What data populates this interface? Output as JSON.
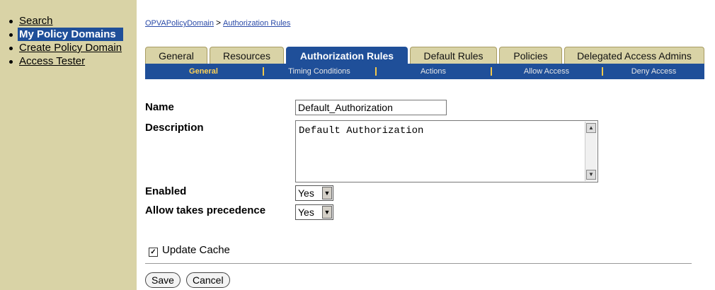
{
  "sidebar": {
    "items": [
      {
        "label": "Search"
      },
      {
        "label": "My Policy Domains"
      },
      {
        "label": "Create Policy Domain"
      },
      {
        "label": "Access Tester"
      }
    ]
  },
  "breadcrumb": {
    "domain": "OPVAPolicyDomain",
    "separator": ">",
    "current": "Authorization Rules"
  },
  "tabs": [
    "General",
    "Resources",
    "Authorization Rules",
    "Default Rules",
    "Policies",
    "Delegated Access Admins"
  ],
  "subtabs": [
    "General",
    "Timing Conditions",
    "Actions",
    "Allow Access",
    "Deny Access"
  ],
  "form": {
    "name_label": "Name",
    "name_value": "Default_Authorization",
    "description_label": "Description",
    "description_value": "Default Authorization",
    "enabled_label": "Enabled",
    "enabled_value": "Yes",
    "allow_label": "Allow takes precedence",
    "allow_value": "Yes",
    "update_cache_label": "Update Cache",
    "update_cache_checked": true
  },
  "buttons": {
    "save": "Save",
    "cancel": "Cancel"
  },
  "colors": {
    "sidebar_bg": "#d9d3a6",
    "accent_blue": "#1f4f99",
    "active_subtab": "#ffd257"
  }
}
